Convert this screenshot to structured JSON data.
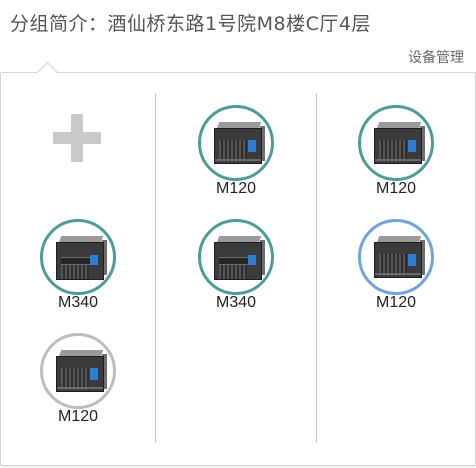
{
  "header": {
    "title": "分组简介：酒仙桥东路1号院M8楼C厅4层"
  },
  "toolbar": {
    "manage_label": "设备管理"
  },
  "columns": [
    {
      "devices": [
        {
          "label": "M340",
          "ring": "teal",
          "icon": "server-m340-icon"
        },
        {
          "label": "M120",
          "ring": "gray",
          "icon": "server-m120-icon"
        }
      ]
    },
    {
      "devices": [
        {
          "label": "M120",
          "ring": "teal",
          "icon": "server-m120-icon"
        },
        {
          "label": "M340",
          "ring": "teal",
          "icon": "server-m340-icon"
        }
      ]
    },
    {
      "devices": [
        {
          "label": "M120",
          "ring": "teal",
          "icon": "server-m120-icon"
        },
        {
          "label": "M120",
          "ring": "blue",
          "icon": "server-m120-icon"
        }
      ]
    }
  ],
  "icons": {
    "add": "plus-icon"
  },
  "colors": {
    "ring_teal": "#4e9c97",
    "ring_gray": "#bdbdbd",
    "ring_blue": "#6fa5dc"
  }
}
